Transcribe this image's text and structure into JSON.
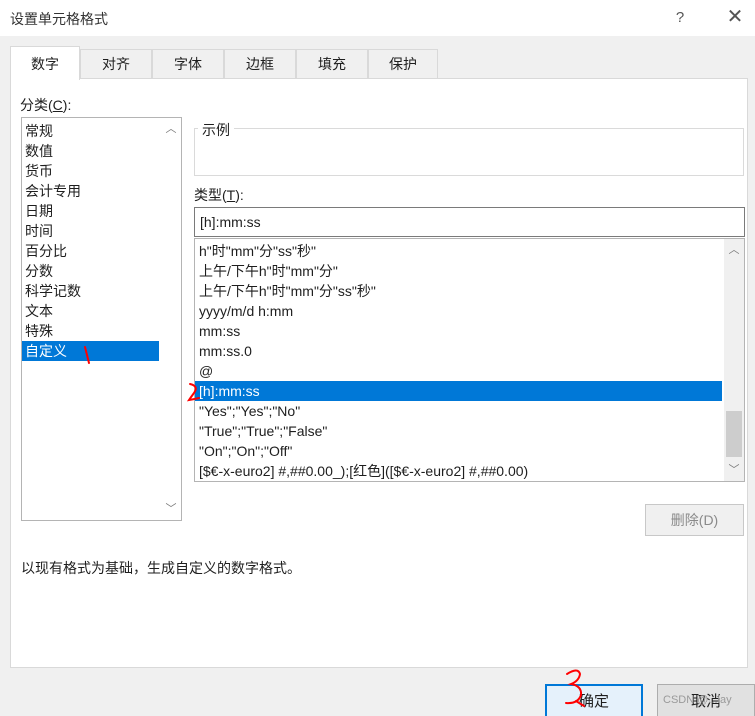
{
  "window": {
    "title": "设置单元格格式",
    "help": "?",
    "close": "✕"
  },
  "tabs": [
    {
      "label": "数字",
      "active": true
    },
    {
      "label": "对齐"
    },
    {
      "label": "字体"
    },
    {
      "label": "边框"
    },
    {
      "label": "填充"
    },
    {
      "label": "保护"
    }
  ],
  "category": {
    "label_prefix": "分类(",
    "label_key": "C",
    "label_suffix": "):",
    "items": [
      "常规",
      "数值",
      "货币",
      "会计专用",
      "日期",
      "时间",
      "百分比",
      "分数",
      "科学记数",
      "文本",
      "特殊",
      "自定义"
    ],
    "selected": "自定义"
  },
  "sample": {
    "label": "示例",
    "value": ""
  },
  "type": {
    "label_prefix": "类型(",
    "label_key": "T",
    "label_suffix": "):",
    "value": "[h]:mm:ss"
  },
  "formats": {
    "items": [
      "h\"时\"mm\"分\"ss\"秒\"",
      "上午/下午h\"时\"mm\"分\"",
      "上午/下午h\"时\"mm\"分\"ss\"秒\"",
      "yyyy/m/d h:mm",
      "mm:ss",
      "mm:ss.0",
      "@",
      "[h]:mm:ss",
      "\"Yes\";\"Yes\";\"No\"",
      "\"True\";\"True\";\"False\"",
      "\"On\";\"On\";\"Off\"",
      "[$€-x-euro2] #,##0.00_);[红色]([$€-x-euro2] #,##0.00)"
    ],
    "selected": "[h]:mm:ss"
  },
  "buttons": {
    "delete": "删除(D)",
    "ok": "确定",
    "cancel": "取消"
  },
  "description": "以现有格式为基础，生成自定义的数字格式。",
  "watermark": "CSDN @...lay",
  "colors": {
    "accent": "#0078d7",
    "annotation": "#ff0000"
  }
}
